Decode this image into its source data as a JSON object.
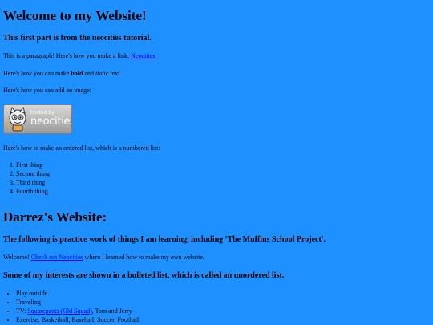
{
  "intro": {
    "title": "Welcome to my Website!",
    "subtitle": "This first part is from the neocities tutorial.",
    "link_para": {
      "before": "This is a paragraph! Here's how you make a link: ",
      "link_text": "Neocities",
      "after": "."
    },
    "format_para": {
      "before": "Here's how you can make ",
      "bold": "bold",
      "middle": " and ",
      "italic": "italic",
      "after": " text."
    },
    "image_para": "Here's how you can add an image:",
    "badge": {
      "small_text": "hosted by",
      "brand_text": "neocities"
    },
    "ordered_intro": "Here's how to make an ordered list, which is a numbered list:",
    "ordered_items": [
      "First thing",
      "Second thing",
      "Third thing",
      "Fourth thing"
    ]
  },
  "darrez": {
    "title": "Darrez's Website:",
    "subtitle": "The following is practice work of things I am learning, including 'The Muffins School Project'.",
    "welcome_para": {
      "before": "Welcome! ",
      "link_text": "Check out Neocities",
      "after": " where I learned how to make my own website."
    },
    "interests_heading": "Some of my interests are shown in a bulleted list, which is called an unordered list.",
    "interests": {
      "item1": "Play outside",
      "item2": "Traveling",
      "item3_before": "TV: ",
      "item3_link": "Squarepants (Old Squad)",
      "item3_after": ", Tom and Jerry",
      "item4": "Exercise: Basketball, Baseball, Soccer, Football"
    }
  },
  "colors": {
    "background": "#1e90ff",
    "link": "#0000ee",
    "text": "#000000"
  }
}
